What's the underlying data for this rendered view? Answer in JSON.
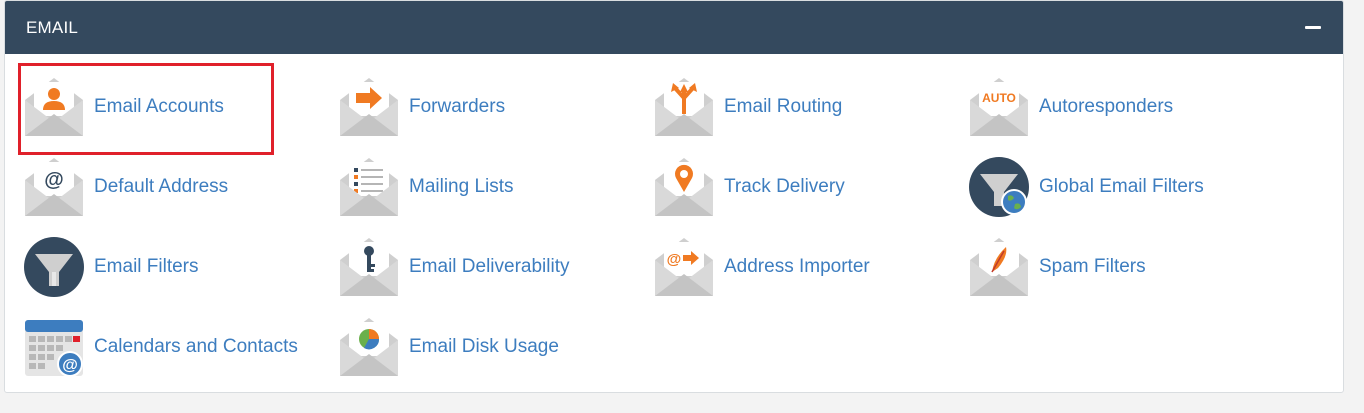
{
  "section": {
    "title": "EMAIL",
    "collapse_label": "−"
  },
  "items": [
    {
      "label": "Email Accounts",
      "icon": "email-accounts-icon"
    },
    {
      "label": "Forwarders",
      "icon": "forwarders-icon"
    },
    {
      "label": "Email Routing",
      "icon": "email-routing-icon"
    },
    {
      "label": "Autoresponders",
      "icon": "autoresponders-icon",
      "badge": "AUTO"
    },
    {
      "label": "Default Address",
      "icon": "default-address-icon"
    },
    {
      "label": "Mailing Lists",
      "icon": "mailing-lists-icon"
    },
    {
      "label": "Track Delivery",
      "icon": "track-delivery-icon"
    },
    {
      "label": "Global Email Filters",
      "icon": "global-email-filters-icon"
    },
    {
      "label": "Email Filters",
      "icon": "email-filters-icon"
    },
    {
      "label": "Email Deliverability",
      "icon": "email-deliverability-icon"
    },
    {
      "label": "Address Importer",
      "icon": "address-importer-icon"
    },
    {
      "label": "Spam Filters",
      "icon": "spam-filters-icon"
    },
    {
      "label": "Calendars and Contacts",
      "icon": "calendars-and-contacts-icon"
    },
    {
      "label": "Email Disk Usage",
      "icon": "email-disk-usage-icon"
    }
  ],
  "colors": {
    "header_bg": "#34495e",
    "link": "#3d7dbf",
    "accent_orange": "#f07a22",
    "highlight": "#e0202a"
  }
}
